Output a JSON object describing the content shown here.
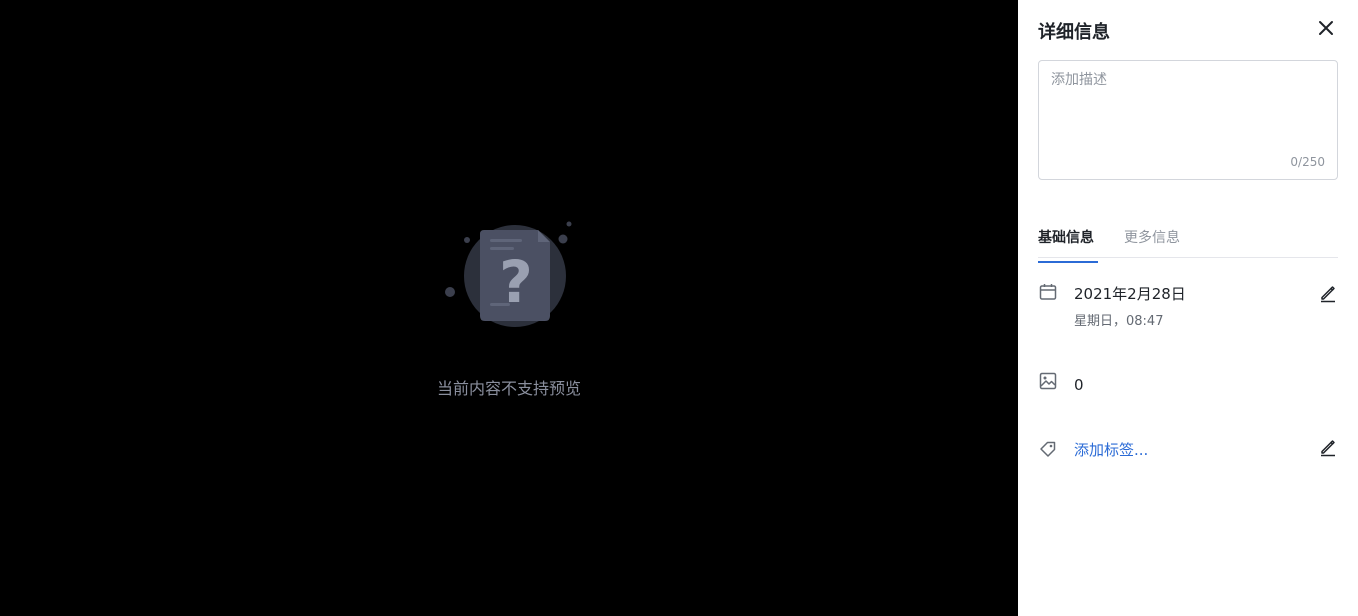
{
  "viewer": {
    "message": "当前内容不支持预览",
    "icon": "file-question-icon"
  },
  "panel": {
    "title": "详细信息",
    "close_icon": "close-icon",
    "description": {
      "placeholder": "添加描述",
      "value": "",
      "counter": "0/250"
    },
    "tabs": [
      {
        "label": "基础信息",
        "active": true
      },
      {
        "label": "更多信息",
        "active": false
      }
    ],
    "date": {
      "icon": "calendar-icon",
      "main": "2021年2月28日",
      "sub": "星期日，08:47",
      "edit_icon": "pencil-icon"
    },
    "images": {
      "icon": "image-icon",
      "count": "0"
    },
    "tags": {
      "icon": "tag-icon",
      "add_label": "添加标签...",
      "edit_icon": "pencil-icon"
    }
  },
  "colors": {
    "viewer_bg": "#000000",
    "panel_bg": "#ffffff",
    "accent": "#2b6bd6",
    "muted_text": "#8f959e"
  }
}
